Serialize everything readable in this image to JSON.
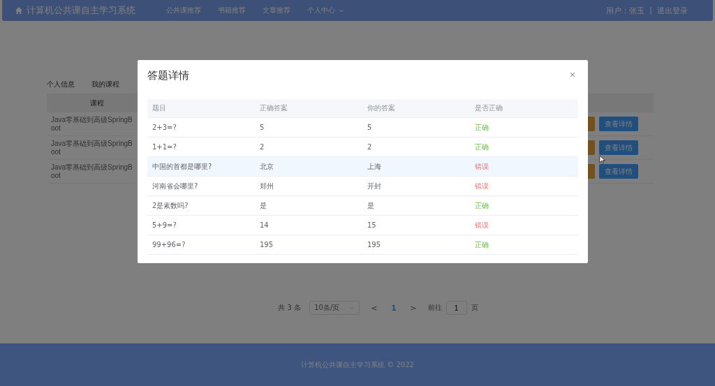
{
  "header": {
    "title": "计算机公共课自主学习系统",
    "nav": [
      {
        "label": "公共课推荐",
        "dropdown": false
      },
      {
        "label": "书籍推荐",
        "dropdown": false
      },
      {
        "label": "文章推荐",
        "dropdown": false
      },
      {
        "label": "个人中心",
        "dropdown": true
      }
    ],
    "user_label": "用户：张玉",
    "separator": "|",
    "logout": "退出登录"
  },
  "tabs": [
    {
      "label": "个人信息",
      "selected": false
    },
    {
      "label": "我的课程",
      "selected": false
    }
  ],
  "table": {
    "columns": [
      "课程"
    ],
    "rows": [
      {
        "course": "Java零基础到高级SpringBoot",
        "action": "查看详情"
      },
      {
        "course": "Java零基础到高级SpringBoot",
        "action": "查看详情"
      },
      {
        "course": "Java零基础到高级SpringBoot",
        "action": "查看详情"
      }
    ]
  },
  "pagination": {
    "total": "共 3 条",
    "page_size": "10条/页",
    "prev": "<",
    "pages": [
      {
        "label": "1",
        "selected": true
      }
    ],
    "next": ">",
    "goto_label": "前往",
    "goto_value": "1",
    "goto_unit": "页"
  },
  "dialog": {
    "title": "答题详情",
    "close": "×",
    "columns": [
      "题目",
      "正确答案",
      "你的答案",
      "是否正确"
    ],
    "rows": [
      {
        "question": "2+3=?",
        "answer": "5",
        "your_answer": "5",
        "result": "正确",
        "correct": true,
        "highlighted": false
      },
      {
        "question": "1+1=?",
        "answer": "2",
        "your_answer": "2",
        "result": "正确",
        "correct": true,
        "highlighted": false
      },
      {
        "question": "中国的首都是哪里?",
        "answer": "北京",
        "your_answer": "上海",
        "result": "错误",
        "correct": false,
        "highlighted": true
      },
      {
        "question": "河南省会哪里?",
        "answer": "郑州",
        "your_answer": "开封",
        "result": "错误",
        "correct": false,
        "highlighted": false
      },
      {
        "question": "2是素数吗?",
        "answer": "是",
        "your_answer": "是",
        "result": "正确",
        "correct": true,
        "highlighted": false
      },
      {
        "question": "5+9=?",
        "answer": "14",
        "your_answer": "15",
        "result": "错误",
        "correct": false,
        "highlighted": false
      },
      {
        "question": "99+96=?",
        "answer": "195",
        "your_answer": "195",
        "result": "正确",
        "correct": true,
        "highlighted": false
      }
    ]
  },
  "footer": "计算机公共课自主学习系统 © 2022"
}
